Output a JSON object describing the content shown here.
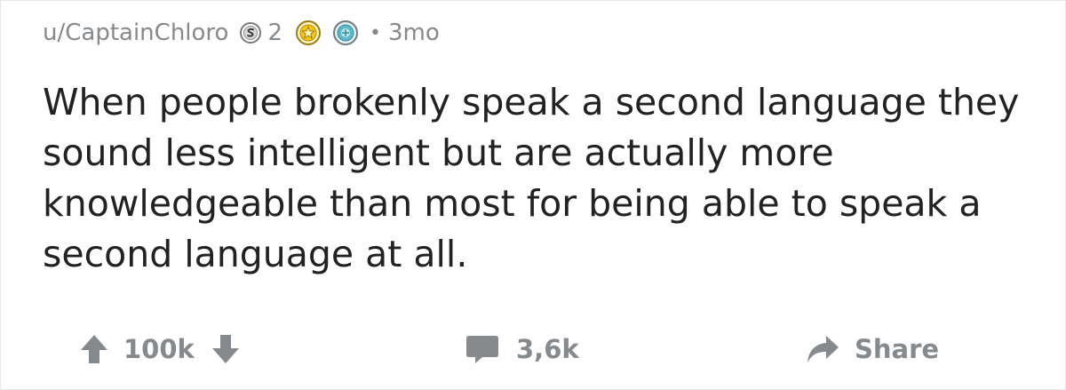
{
  "post": {
    "username": "u/CaptainChloro",
    "silver_count": "2",
    "separator": "•",
    "age": "3mo",
    "body": "When people brokenly speak a second language they sound less intelligent but are actually more knowledgeable than most for being able to speak a second language at all."
  },
  "actions": {
    "score": "100k",
    "comments": "3,6k",
    "share": "Share"
  },
  "icons": {
    "silver_award": "silver-award-icon",
    "gold_award": "gold-award-icon",
    "platinum_award": "platinum-award-icon",
    "upvote": "upvote-arrow-icon",
    "downvote": "downvote-arrow-icon",
    "comment": "comment-bubble-icon",
    "share": "share-arrow-icon"
  },
  "colors": {
    "meta_text": "#878a8c",
    "body_text": "#222222",
    "gold": "#f5c518",
    "platinum": "#5fb8c9"
  }
}
